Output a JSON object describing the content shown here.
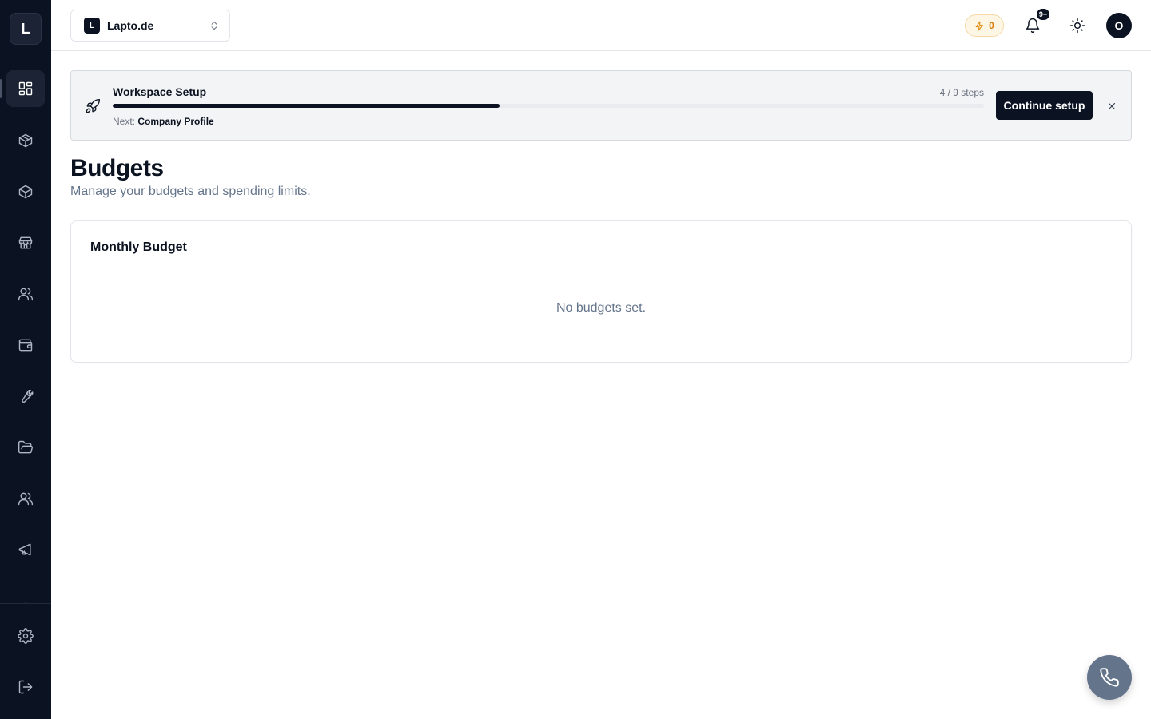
{
  "sidebar": {
    "logo_letter": "L",
    "items": [
      {
        "icon": "dashboard-grid-icon",
        "active": true
      },
      {
        "icon": "box-icon",
        "active": false
      },
      {
        "icon": "package-icon",
        "active": false
      },
      {
        "icon": "store-icon",
        "active": false
      },
      {
        "icon": "users-icon",
        "active": false
      },
      {
        "icon": "wallet-icon",
        "active": false
      },
      {
        "icon": "wrench-icon",
        "active": false
      },
      {
        "icon": "folder-open-icon",
        "active": false
      },
      {
        "icon": "team-icon",
        "active": false
      },
      {
        "icon": "megaphone-icon",
        "active": false
      },
      {
        "icon": "bot-icon",
        "active": false
      }
    ],
    "bottom_items": [
      {
        "icon": "settings-gear-icon"
      },
      {
        "icon": "logout-icon"
      }
    ]
  },
  "header": {
    "workspace": {
      "badge": "L",
      "name": "Lapto.de"
    },
    "credits": "0",
    "notifications_badge": "9+",
    "avatar_letter": "O"
  },
  "setup_banner": {
    "title": "Workspace Setup",
    "steps_text": "4 / 9 steps",
    "progress_fraction": 0.4444,
    "next_prefix": "Next:",
    "next_step": "Company Profile",
    "continue_label": "Continue setup"
  },
  "page": {
    "title": "Budgets",
    "subtitle": "Manage your budgets and spending limits."
  },
  "budget_card": {
    "title": "Monthly Budget",
    "empty_text": "No budgets set."
  },
  "colors": {
    "sidebar_bg": "#0b1222",
    "primary": "#0b1222",
    "credits_accent": "#d97706",
    "fab_bg": "#64748b"
  }
}
